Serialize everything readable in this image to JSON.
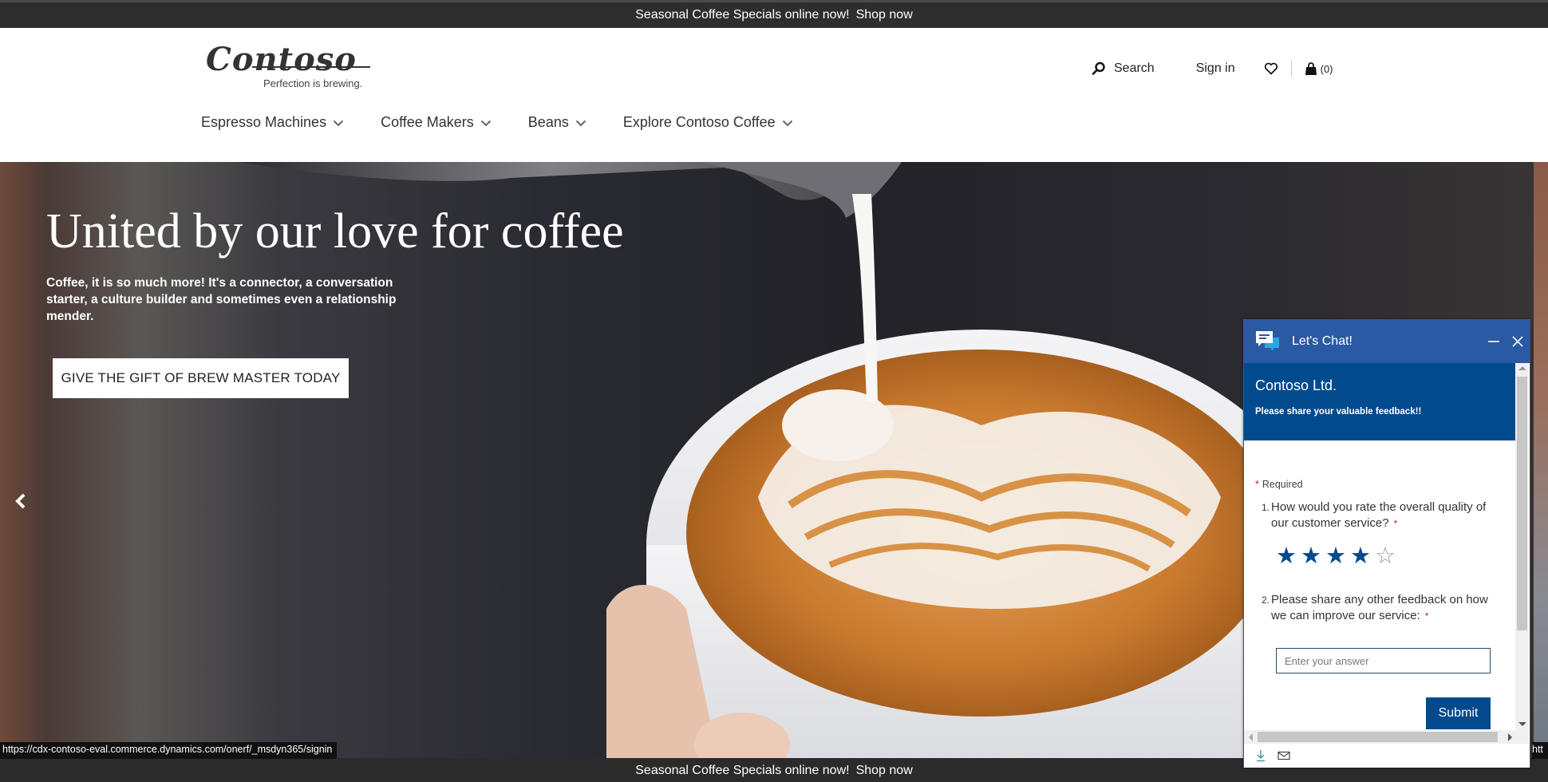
{
  "promo_banner": {
    "text": "Seasonal Coffee Specials online now!",
    "link": "Shop now"
  },
  "header": {
    "logo": {
      "name": "Contoso",
      "tagline": "Perfection is brewing."
    },
    "utility": {
      "search_label": "Search",
      "signin_label": "Sign in",
      "wishlist_icon": "heart-icon",
      "cart_icon": "shopping-bag-icon",
      "cart_count": "(0)"
    },
    "nav": [
      {
        "label": "Espresso Machines",
        "icon": "chevron-down-icon"
      },
      {
        "label": "Coffee Makers",
        "icon": "chevron-down-icon"
      },
      {
        "label": "Beans",
        "icon": "chevron-down-icon"
      },
      {
        "label": "Explore Contoso Coffee",
        "icon": "chevron-down-icon"
      }
    ]
  },
  "hero": {
    "title": "United by our love for coffee",
    "subtitle": "Coffee, it is so much more! It's a connector, a conversation starter, a culture builder and sometimes even a relationship mender.",
    "cta_label": "GIVE THE GIFT OF BREW MASTER TODAY",
    "prev_icon": "chevron-left-icon"
  },
  "status_bar": {
    "url": "https://cdx-contoso-eval.commerce.dynamics.com/onerf/_msdyn365/signin",
    "right_fragment": "htt"
  },
  "chat": {
    "title": "Let's Chat!",
    "org_name": "Contoso Ltd.",
    "banner_message": "Please share your valuable feedback!!",
    "required_label": "Required",
    "questions": [
      {
        "number": "1.",
        "text": "How would you rate the overall quality of our customer service?",
        "required": "*"
      },
      {
        "number": "2.",
        "text": "Please share any other feedback on how we can improve our service:",
        "required": "*"
      }
    ],
    "rating": {
      "value": 4,
      "max": 5,
      "filled_glyph": "★",
      "empty_glyph": "☆"
    },
    "answer_placeholder": "Enter your answer",
    "answer_value": "",
    "submit_label": "Submit",
    "colors": {
      "header": "#2b5aa4",
      "banner": "#014a8e",
      "accent": "#014a8e",
      "required": "#c41e1e"
    }
  }
}
